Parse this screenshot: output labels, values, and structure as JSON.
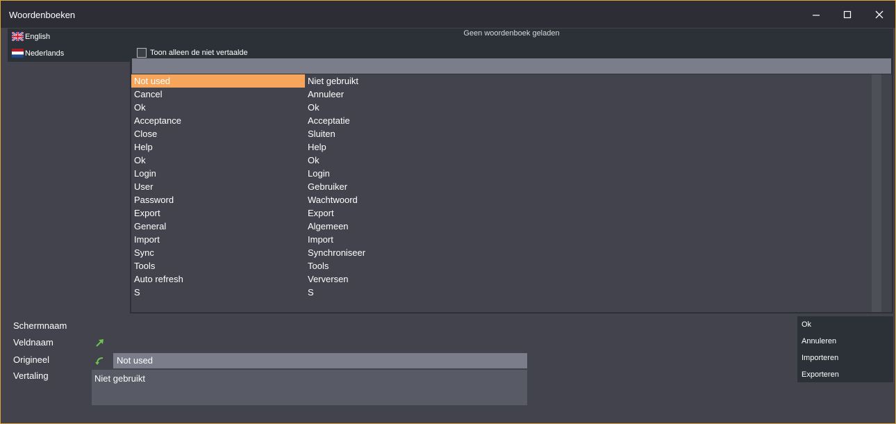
{
  "window": {
    "title": "Woordenboeken",
    "controls": [
      "minimize",
      "maximize",
      "close"
    ],
    "accent": "#e0a43a"
  },
  "languages": [
    {
      "label": "English",
      "flag": "uk-flag-icon"
    },
    {
      "label": "Nederlands",
      "flag": "netherlands-flag-icon"
    }
  ],
  "panel": {
    "header": "Geen woordenboek geladen",
    "filter_checkbox_label": "Toon alleen de niet vertaalde",
    "filter_value": ""
  },
  "entries": [
    {
      "original": "Not used",
      "translation": "Niet gebruikt",
      "selected": true
    },
    {
      "original": "Cancel",
      "translation": "Annuleer"
    },
    {
      "original": "Ok",
      "translation": "Ok"
    },
    {
      "original": "Acceptance",
      "translation": "Acceptatie"
    },
    {
      "original": "Close",
      "translation": "Sluiten"
    },
    {
      "original": "Help",
      "translation": "Help"
    },
    {
      "original": "Ok",
      "translation": "Ok"
    },
    {
      "original": "Login",
      "translation": "Login"
    },
    {
      "original": "User",
      "translation": "Gebruiker"
    },
    {
      "original": "Password",
      "translation": "Wachtwoord"
    },
    {
      "original": "Export",
      "translation": "Export"
    },
    {
      "original": "General",
      "translation": "Algemeen"
    },
    {
      "original": "Import",
      "translation": "Import"
    },
    {
      "original": "Sync",
      "translation": "Synchroniseer"
    },
    {
      "original": "Tools",
      "translation": "Tools"
    },
    {
      "original": "Auto refresh",
      "translation": "Verversen"
    },
    {
      "original": "S",
      "translation": "S"
    }
  ],
  "selection_color": "#f6a55a",
  "details": {
    "screen_label": "Schermnaam",
    "field_label": "Veldnaam",
    "original_label": "Origineel",
    "translation_label": "Vertaling",
    "original_value": "Not used",
    "translation_value": "Niet gebruikt",
    "field_icon": "arrow-up-right-icon",
    "original_icon": "undo-arrow-icon",
    "icon_color": "#6fc24f"
  },
  "actions": {
    "ok": "Ok",
    "cancel": "Annuleren",
    "import": "Importeren",
    "export": "Exporteren"
  }
}
